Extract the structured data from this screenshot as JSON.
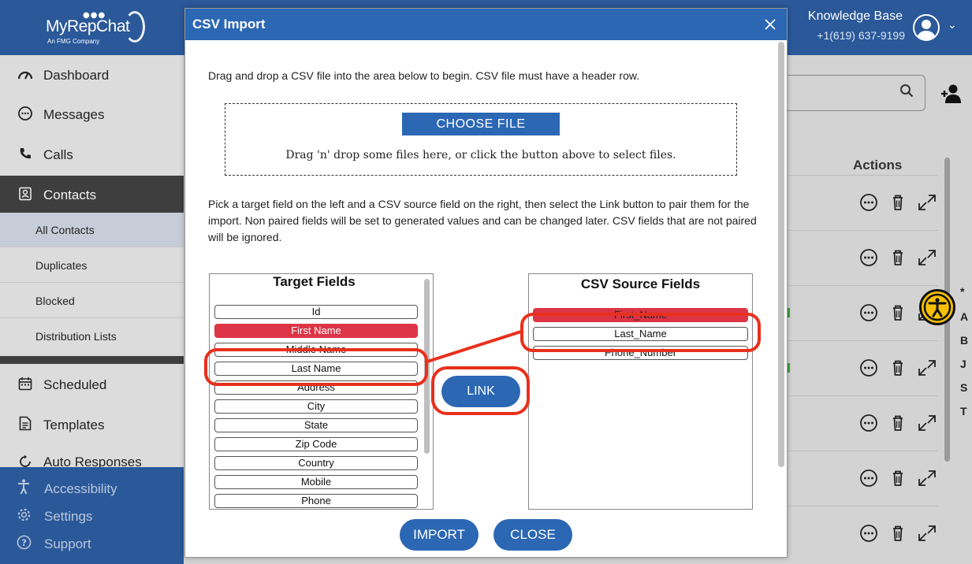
{
  "header": {
    "logo_text": "MyRepChat",
    "logo_sub": "An FMG Company",
    "account_name": "Knowledge Base",
    "account_phone": "+1(619) 637-9199"
  },
  "sidebar": {
    "items": [
      {
        "label": "Dashboard",
        "icon": "gauge-icon"
      },
      {
        "label": "Messages",
        "icon": "chat-icon"
      },
      {
        "label": "Calls",
        "icon": "phone-icon"
      },
      {
        "label": "Contacts",
        "icon": "contact-card-icon"
      }
    ],
    "sub_items": [
      "All Contacts",
      "Duplicates",
      "Blocked",
      "Distribution Lists"
    ],
    "items2": [
      {
        "label": "Scheduled",
        "icon": "calendar-icon"
      },
      {
        "label": "Templates",
        "icon": "document-icon"
      },
      {
        "label": "Auto Responses",
        "icon": "refresh-icon"
      }
    ],
    "bottom": [
      {
        "label": "Accessibility",
        "icon": "accessibility-icon"
      },
      {
        "label": "Settings",
        "icon": "gear-icon"
      },
      {
        "label": "Support",
        "icon": "question-icon"
      }
    ]
  },
  "main": {
    "actions_header": "Actions",
    "alphabet": [
      "*",
      "A",
      "B",
      "J",
      "S",
      "T"
    ]
  },
  "modal": {
    "title": "CSV Import",
    "intro": "Drag and drop a CSV file into the area below to begin. CSV file must have a header row.",
    "choose_file_label": "CHOOSE FILE",
    "drop_hint": "Drag 'n' drop some files here, or click the button above to select files.",
    "instructions": "Pick a target field on the left and a CSV source field on the right, then select the Link button to pair them for the import. Non paired fields will be set to generated values and can be changed later. CSV fields that are not paired will be ignored.",
    "target_title": "Target Fields",
    "target_fields": [
      "Id",
      "First Name",
      "Middle Name",
      "Last Name",
      "Address",
      "City",
      "State",
      "Zip Code",
      "Country",
      "Mobile",
      "Phone"
    ],
    "source_title": "CSV Source Fields",
    "source_fields": [
      "First_Name",
      "Last_Name",
      "Phone_Number"
    ],
    "link_label": "LINK",
    "import_label": "IMPORT",
    "close_label": "CLOSE"
  },
  "colors": {
    "brand_blue": "#2a5899",
    "modal_blue": "#2c67b4",
    "paired_red": "#dd3546",
    "highlight_red": "#e8301c",
    "accessibility_yellow": "#f6c000"
  }
}
